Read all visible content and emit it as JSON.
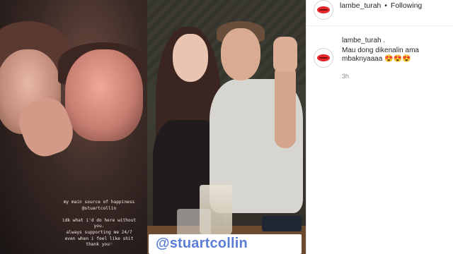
{
  "story": {
    "caption_lines": [
      "my main source of happiness",
      "@stuartcollin",
      "",
      "idk what i'd do here without",
      "you.",
      "always supporting me 24/7",
      "even when i feel like shit",
      "thank you♡"
    ]
  },
  "post_photo": {
    "tag": "@stuartcollin"
  },
  "header": {
    "username": "lambe_turah",
    "separator": "•",
    "follow_status": "Following"
  },
  "comment": {
    "username": "lambe_turah .",
    "text": "Mau dong dikenalin ama mbaknyaaaa 😍😍😍",
    "time": "3h"
  },
  "icons": {
    "avatar": "red-lips-logo"
  },
  "colors": {
    "tag_text": "#5a7dd6",
    "lips": "#e5262b"
  }
}
